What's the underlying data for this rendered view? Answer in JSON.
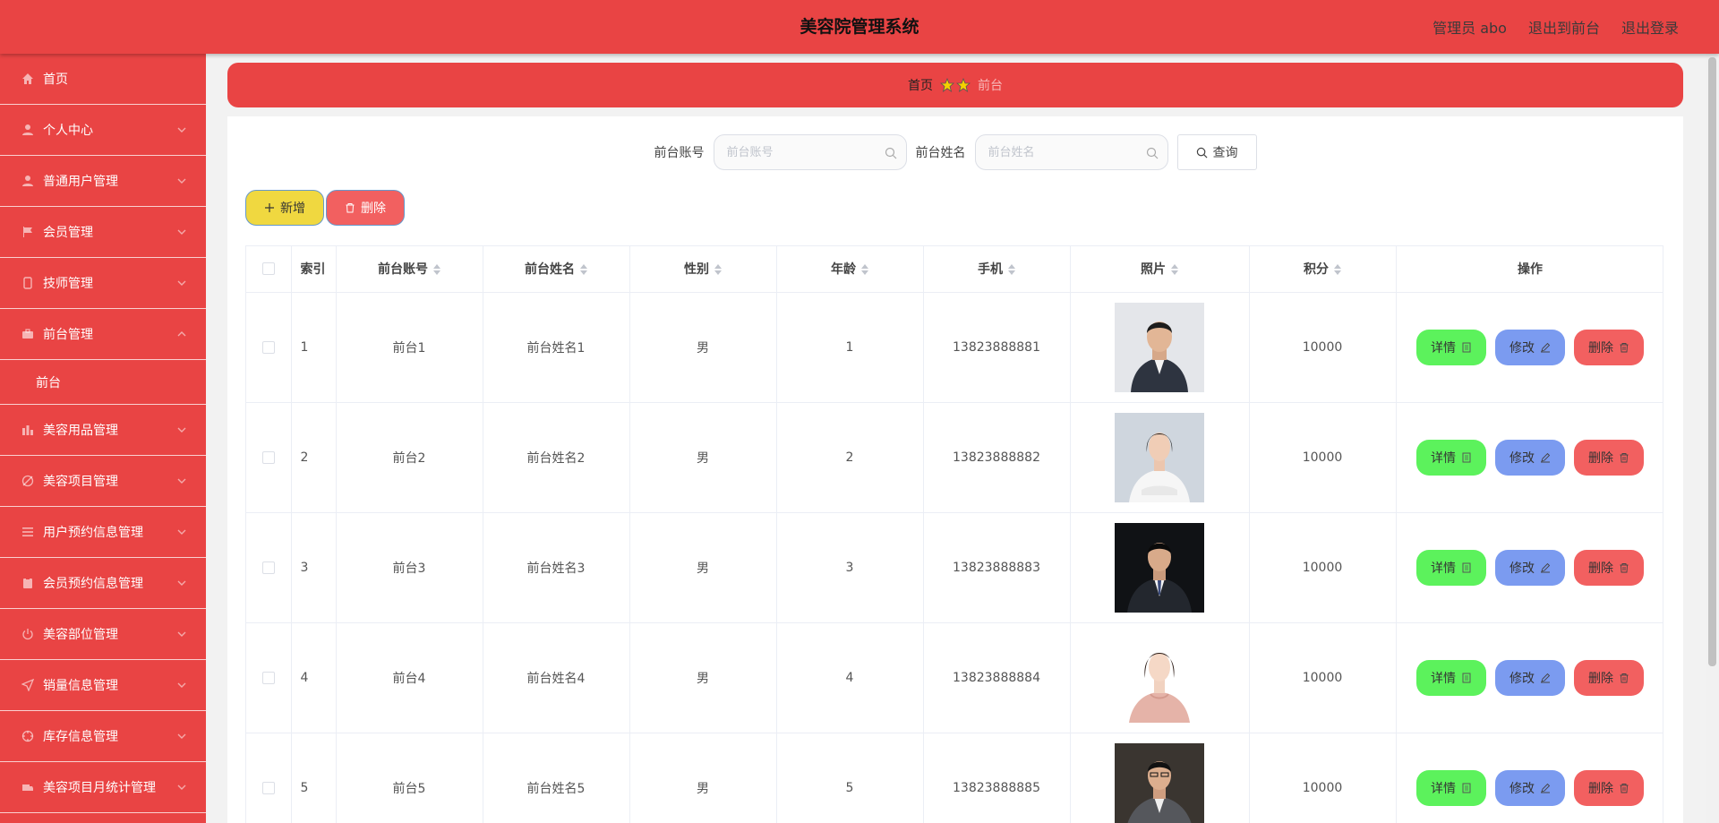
{
  "header": {
    "title": "美容院管理系统",
    "user": "管理员 abo",
    "to_front": "退出到前台",
    "logout": "退出登录"
  },
  "sidebar": {
    "items": [
      {
        "label": "首页",
        "icon": "home-icon",
        "expandable": false
      },
      {
        "label": "个人中心",
        "icon": "user-icon",
        "expandable": true
      },
      {
        "label": "普通用户管理",
        "icon": "user-icon",
        "expandable": true
      },
      {
        "label": "会员管理",
        "icon": "flag-icon",
        "expandable": true
      },
      {
        "label": "技师管理",
        "icon": "phone-icon",
        "expandable": true
      },
      {
        "label": "前台管理",
        "icon": "briefcase-icon",
        "expandable": true,
        "open": true,
        "children": [
          "前台"
        ]
      },
      {
        "label": "美容用品管理",
        "icon": "chart-icon",
        "expandable": true
      },
      {
        "label": "美容项目管理",
        "icon": "clock-icon",
        "expandable": true
      },
      {
        "label": "用户预约信息管理",
        "icon": "list-icon",
        "expandable": true
      },
      {
        "label": "会员预约信息管理",
        "icon": "clipboard-icon",
        "expandable": true
      },
      {
        "label": "美容部位管理",
        "icon": "power-icon",
        "expandable": true
      },
      {
        "label": "销量信息管理",
        "icon": "send-icon",
        "expandable": true
      },
      {
        "label": "库存信息管理",
        "icon": "compass-icon",
        "expandable": true
      },
      {
        "label": "美容项目月统计管理",
        "icon": "truck-icon",
        "expandable": true
      }
    ]
  },
  "breadcrumb": {
    "home": "首页",
    "current": "前台"
  },
  "search": {
    "account_label": "前台账号",
    "account_placeholder": "前台账号",
    "name_label": "前台姓名",
    "name_placeholder": "前台姓名",
    "query_label": "查询"
  },
  "actions": {
    "add_label": "新增",
    "delete_label": "删除"
  },
  "table": {
    "columns": [
      "索引",
      "前台账号",
      "前台姓名",
      "性别",
      "年龄",
      "手机",
      "照片",
      "积分",
      "操作"
    ],
    "rows": [
      {
        "index": "1",
        "account": "前台1",
        "name": "前台姓名1",
        "gender": "男",
        "age": "1",
        "phone": "13823888881",
        "points": "10000"
      },
      {
        "index": "2",
        "account": "前台2",
        "name": "前台姓名2",
        "gender": "男",
        "age": "2",
        "phone": "13823888882",
        "points": "10000"
      },
      {
        "index": "3",
        "account": "前台3",
        "name": "前台姓名3",
        "gender": "男",
        "age": "3",
        "phone": "13823888883",
        "points": "10000"
      },
      {
        "index": "4",
        "account": "前台4",
        "name": "前台姓名4",
        "gender": "男",
        "age": "4",
        "phone": "13823888884",
        "points": "10000"
      },
      {
        "index": "5",
        "account": "前台5",
        "name": "前台姓名5",
        "gender": "男",
        "age": "5",
        "phone": "13823888885",
        "points": "10000"
      }
    ],
    "ops": {
      "detail": "详情",
      "edit": "修改",
      "delete": "删除"
    }
  },
  "colors": {
    "brand": "#e94444",
    "add_button": "#f0d840",
    "delete_button": "#f26060",
    "detail_button": "#5cf25c",
    "edit_button": "#7b9bf0"
  }
}
